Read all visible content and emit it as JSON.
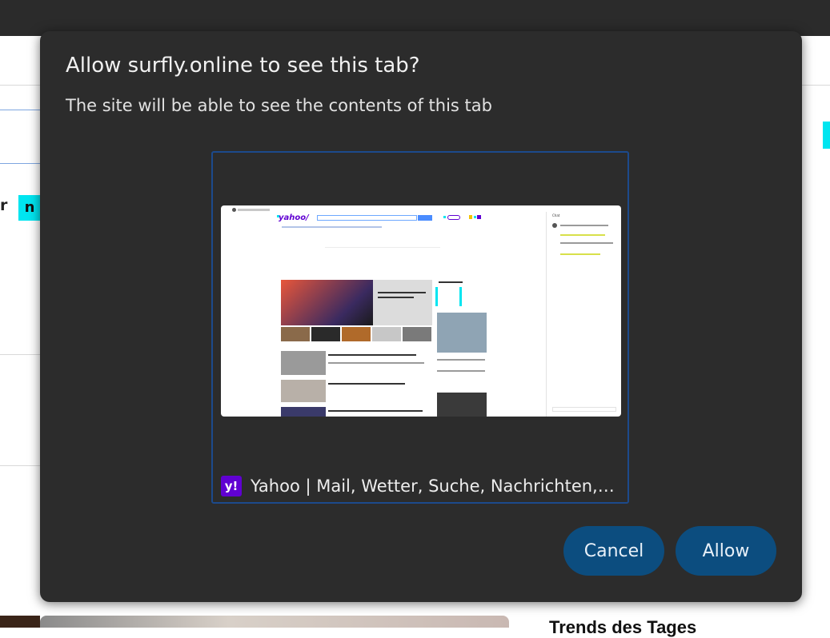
{
  "background": {
    "partial_letter": "r",
    "highlighted_letter": "n",
    "bottom_heading": "Trends des Tages"
  },
  "dialog": {
    "title": "Allow surfly.online to see this tab?",
    "description": "The site will be able to see the contents of this tab",
    "tab": {
      "favicon_text": "y!",
      "title": "Yahoo | Mail, Wetter, Suche, Nachrichten,…"
    },
    "thumbnail": {
      "logo": "yahoo/",
      "chat_title": "Chat"
    },
    "buttons": {
      "cancel": "Cancel",
      "allow": "Allow"
    }
  },
  "colors": {
    "dialog_bg": "#2c2c2c",
    "button_bg": "#0c4d7f",
    "highlight": "#00e5f0",
    "yahoo_purple": "#6001d2",
    "preview_border": "#1c4a8c"
  }
}
